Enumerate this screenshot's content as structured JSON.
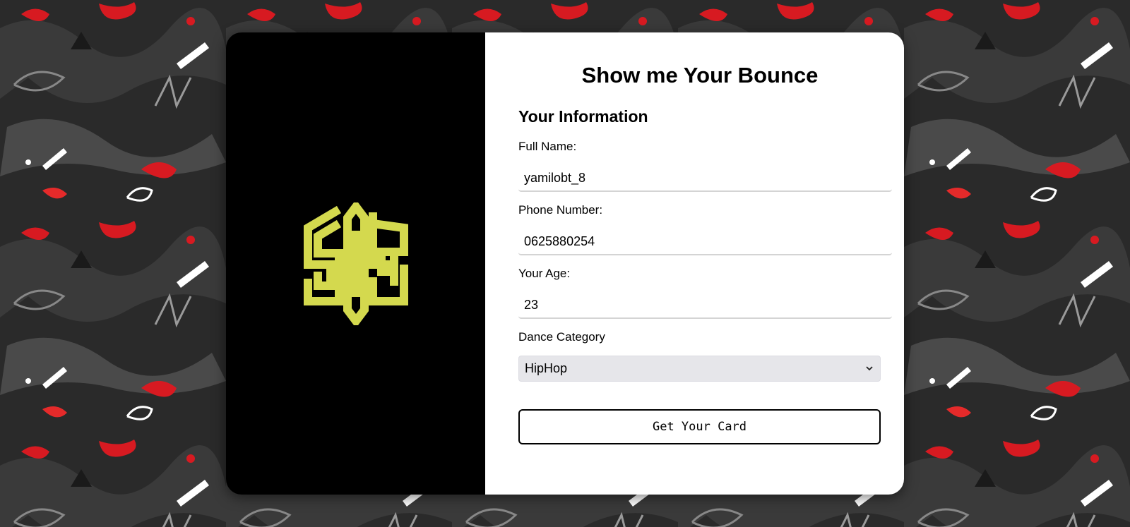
{
  "form": {
    "title": "Show me Your Bounce",
    "section_title": "Your Information",
    "full_name": {
      "label": "Full Name:",
      "value": "yamilobt_8"
    },
    "phone": {
      "label": "Phone Number:",
      "value": "0625880254"
    },
    "age": {
      "label": "Your Age:",
      "value": "23"
    },
    "dance_category": {
      "label": "Dance Category",
      "selected": "HipHop"
    },
    "submit_label": "Get Your Card"
  },
  "logo": {
    "icon": "sos-hexagon-logo-icon",
    "color": "#d4d94e"
  },
  "colors": {
    "card_left": "#000000",
    "card_right": "#ffffff",
    "accent_red": "#d71a21"
  }
}
